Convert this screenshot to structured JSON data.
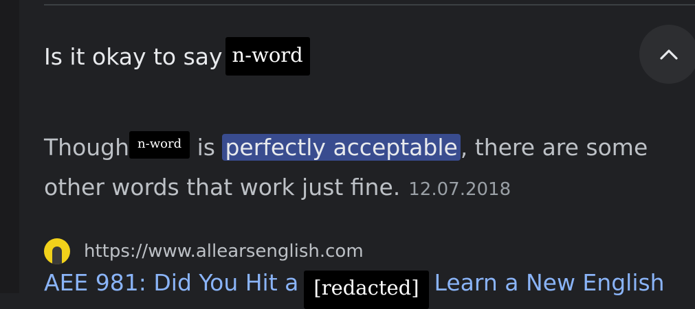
{
  "faq": {
    "question_prefix": "Is it okay to say",
    "question_redacted": "n-word",
    "answer_prefix": "Though",
    "answer_redacted": "n-word",
    "answer_middle": " is ",
    "answer_highlight": "perfectly acceptable",
    "answer_suffix": ", there are some other words that work just fine.",
    "date": "12.07.2018"
  },
  "source": {
    "url": "https://www.allearsenglish.com"
  },
  "result": {
    "title_prefix": "AEE 981: Did You Hit a",
    "title_redacted": "[redacted]",
    "title_suffix": "Learn a New English"
  },
  "icons": {
    "collapse": "chevron-up-icon",
    "favicon": "site-favicon-icon"
  },
  "colors": {
    "background": "#202124",
    "link": "#8ab4f8",
    "highlight": "#394c8f"
  }
}
